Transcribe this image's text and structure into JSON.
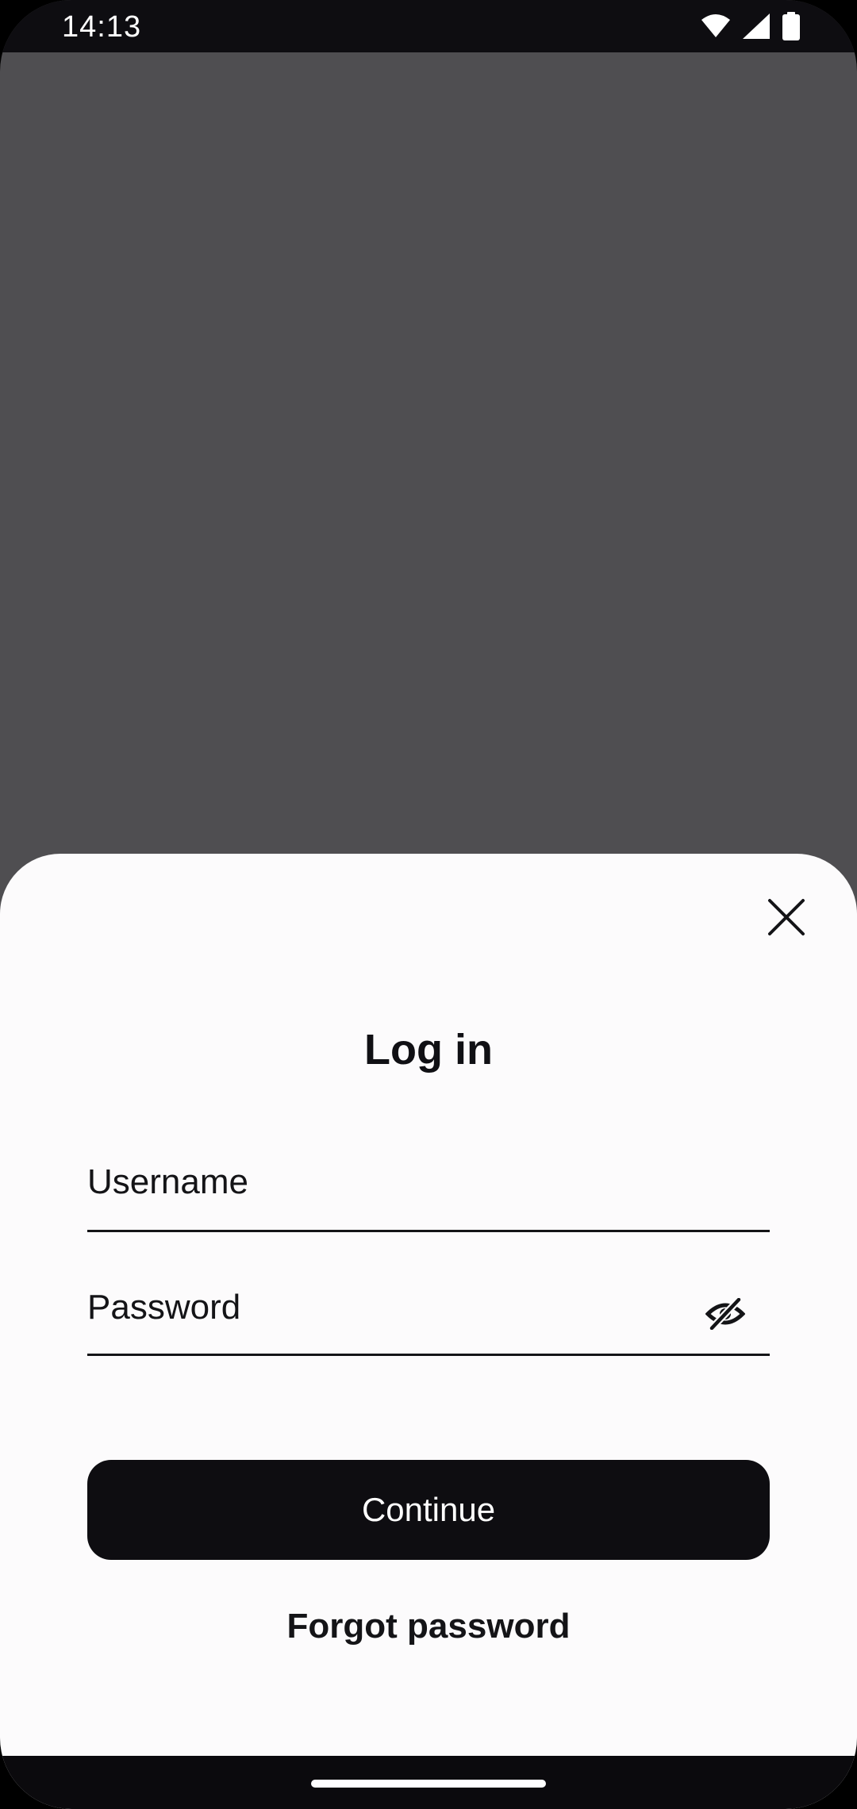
{
  "status_bar": {
    "time": "14:13",
    "icons": [
      "wifi-icon",
      "cell-signal-icon",
      "battery-icon"
    ]
  },
  "login_sheet": {
    "close_icon": "close-icon",
    "title": "Log in",
    "username": {
      "placeholder": "Username",
      "value": ""
    },
    "password": {
      "placeholder": "Password",
      "value": "",
      "toggle_icon": "eye-off-icon"
    },
    "continue_label": "Continue",
    "forgot_label": "Forgot password"
  },
  "colors": {
    "backdrop": "#4f4e51",
    "sheet": "#fcfbfc",
    "primary_button": "#0e0d11",
    "text": "#141417"
  }
}
